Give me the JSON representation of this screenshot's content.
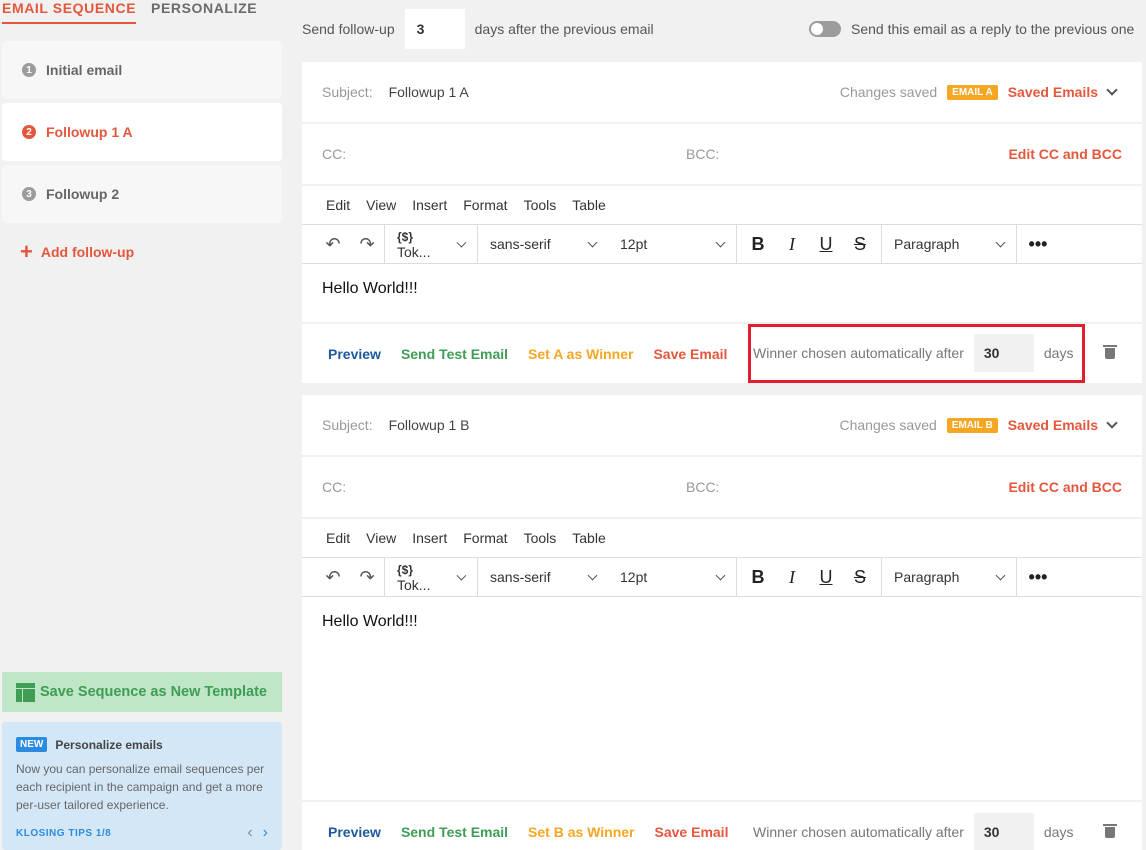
{
  "sidebar": {
    "tabs": [
      {
        "label": "EMAIL SEQUENCE",
        "active": true
      },
      {
        "label": "PERSONALIZE",
        "active": false
      }
    ],
    "steps": [
      {
        "num": "1",
        "label": "Initial email",
        "active": false
      },
      {
        "num": "2",
        "label": "Followup 1 A",
        "active": true
      },
      {
        "num": "3",
        "label": "Followup 2",
        "active": false
      }
    ],
    "add_followup": "Add follow-up",
    "save_template": "Save Sequence as New Template",
    "tips": {
      "badge": "NEW",
      "title": "Personalize emails",
      "body": "Now you can personalize email sequences per each recipient in the campaign and get a more per-user tailored experience.",
      "counter": "KLOSING TIPS 1/8"
    }
  },
  "followup": {
    "prefix": "Send follow-up",
    "days": "3",
    "suffix": "days after the previous email",
    "reply_label": "Send this email as a reply to the previous one",
    "reply_enabled": false
  },
  "editor_menu": [
    "Edit",
    "View",
    "Insert",
    "Format",
    "Tools",
    "Table"
  ],
  "toolbar": {
    "token": "Tok...",
    "font": "sans-serif",
    "size": "12pt",
    "block": "Paragraph"
  },
  "labels": {
    "subject": "Subject:",
    "cc": "CC:",
    "bcc": "BCC:",
    "changes_saved": "Changes saved",
    "saved_emails": "Saved Emails",
    "edit_cc": "Edit CC and BCC",
    "preview": "Preview",
    "send_test": "Send Test Email",
    "save_email": "Save Email",
    "winner_prefix": "Winner chosen automatically after",
    "winner_suffix": "days"
  },
  "variants": [
    {
      "subject": "Followup 1 A",
      "badge": "EMAIL A",
      "body": "Hello World!!!",
      "set_winner": "Set A as Winner",
      "winner_days": "30"
    },
    {
      "subject": "Followup 1 B",
      "badge": "EMAIL B",
      "body": "Hello World!!!",
      "set_winner": "Set B as Winner",
      "winner_days": "30"
    }
  ],
  "colors": {
    "brand": "#e4573d",
    "success": "#3f9d55",
    "warning": "#f5a623",
    "link": "#1c5a9c",
    "highlight": "#e0202a"
  }
}
